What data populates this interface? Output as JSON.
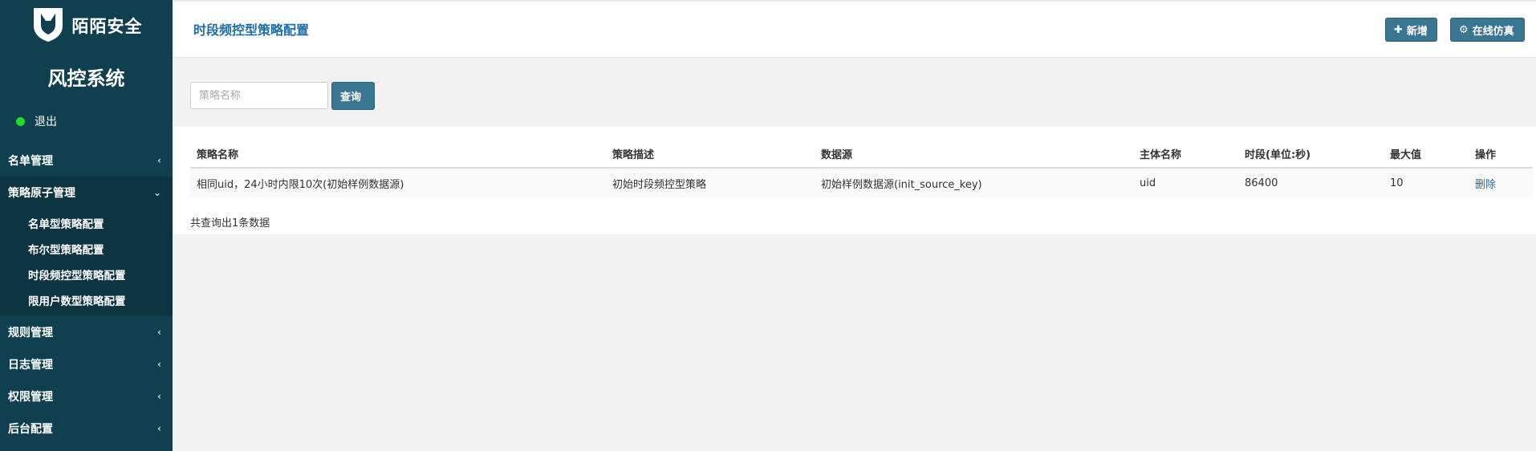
{
  "brand": {
    "name": "陌陌安全",
    "icon": "shield-icon"
  },
  "sidebar": {
    "system_title": "风控系统",
    "logout_label": "退出",
    "menu": [
      {
        "label": "名单管理",
        "icon": "chevron-left-icon"
      },
      {
        "label": "策略原子管理",
        "icon": "chevron-down-icon",
        "children": [
          "名单型策略配置",
          "布尔型策略配置",
          "时段频控型策略配置",
          "限用户数型策略配置"
        ]
      },
      {
        "label": "规则管理",
        "icon": "chevron-left-icon"
      },
      {
        "label": "日志管理",
        "icon": "chevron-left-icon"
      },
      {
        "label": "权限管理",
        "icon": "chevron-left-icon"
      },
      {
        "label": "后台配置",
        "icon": "chevron-left-icon"
      }
    ]
  },
  "header": {
    "title": "时段频控型策略配置",
    "add_button": "新增",
    "simulate_button": "在线仿真"
  },
  "search": {
    "placeholder": "策略名称",
    "value": "",
    "query_button": "查询"
  },
  "table": {
    "columns": [
      "策略名称",
      "策略描述",
      "数据源",
      "主体名称",
      "时段(单位:秒)",
      "最大值",
      "操作"
    ],
    "rows": [
      [
        "相同uid，24小时内限10次(初始样例数据源)",
        "初始时段频控型策略",
        "初始样例数据源(init_source_key)",
        "uid",
        "86400",
        "10",
        "删除"
      ]
    ]
  },
  "result_count": "共查询出1条数据",
  "colors": {
    "sidebar_bg": "#10404f",
    "accent": "#1e6ea7",
    "button": "#3a7591",
    "status_dot": "#22dd22"
  }
}
